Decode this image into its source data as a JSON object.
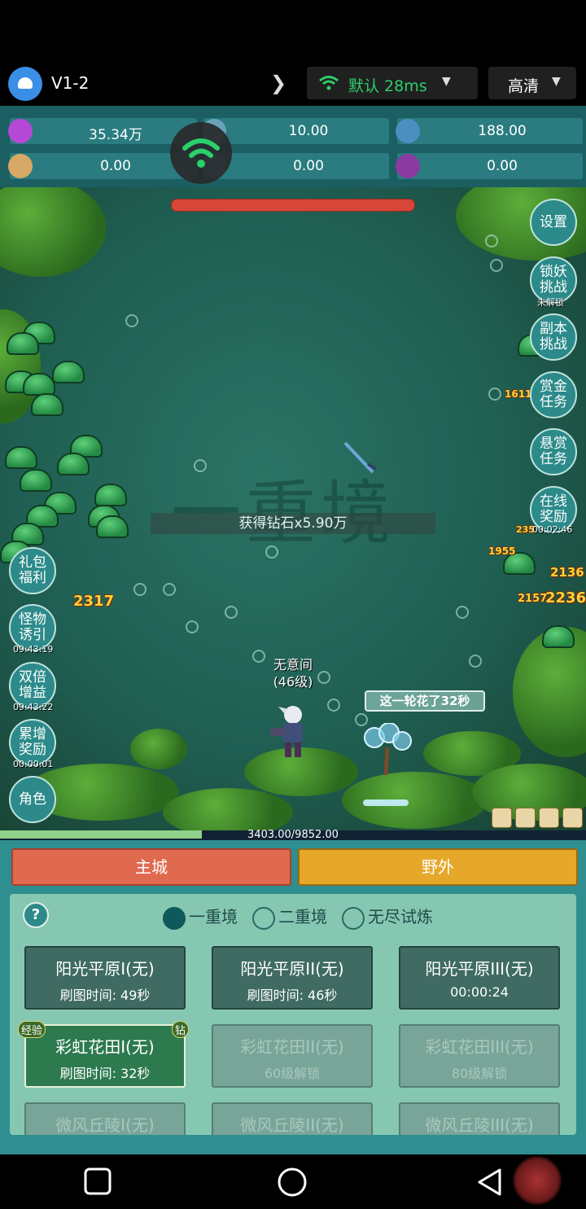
{
  "topbar": {
    "app_title": "V1-2",
    "network_label": "默认 28ms",
    "quality_label": "高清"
  },
  "resources": [
    {
      "icon": "diamond-icon",
      "value": "35.34万"
    },
    {
      "icon": "orb-icon",
      "value": "10.00"
    },
    {
      "icon": "globe-icon",
      "value": "188.00"
    },
    {
      "icon": "scroll-icon",
      "value": "0.00"
    },
    {
      "icon": "crystal-icon",
      "value": "0.00"
    },
    {
      "icon": "potion-icon",
      "value": "0.00"
    }
  ],
  "battle": {
    "watermark": "一重境",
    "gain_message": "获得钻石x5.90万",
    "player_name": "无意间",
    "player_level": "(46级)",
    "round_time": "这一轮花了32秒",
    "hp_text": "3403.00/9852.00",
    "hp_fraction": 0.345,
    "damage_numbers": [
      "2317",
      "1611",
      "1955",
      "2136",
      "2157",
      "2236",
      "235"
    ]
  },
  "right_menu": [
    {
      "label": "设置",
      "sub": ""
    },
    {
      "label": "锁妖挑战",
      "sub": "未解锁"
    },
    {
      "label": "副本挑战",
      "sub": ""
    },
    {
      "label": "赏金任务",
      "sub": ""
    },
    {
      "label": "悬赏任务",
      "sub": ""
    },
    {
      "label": "在线奖励",
      "sub": "00:02:46"
    }
  ],
  "left_menu": [
    {
      "label": "礼包福利",
      "sub": ""
    },
    {
      "label": "怪物诱引",
      "sub": "09:43:19"
    },
    {
      "label": "双倍增益",
      "sub": "09:43:22"
    },
    {
      "label": "累增奖励",
      "sub": "00:00:01"
    },
    {
      "label": "角色",
      "sub": ""
    }
  ],
  "tabs": {
    "main_city": "主城",
    "wild": "野外"
  },
  "realms": {
    "help": "?",
    "items": [
      "一重境",
      "二重境",
      "无尽试炼"
    ],
    "selected": 0
  },
  "stages": [
    {
      "name": "阳光平原I(无)",
      "info": "刷图时间: 49秒",
      "state": "normal"
    },
    {
      "name": "阳光平原II(无)",
      "info": "刷图时间: 46秒",
      "state": "normal"
    },
    {
      "name": "阳光平原III(无)",
      "info": "00:00:24",
      "state": "normal"
    },
    {
      "name": "彩虹花田I(无)",
      "info": "刷图时间: 32秒",
      "state": "active",
      "badge_left": "经验",
      "badge_right": "钻"
    },
    {
      "name": "彩虹花田II(无)",
      "info": "60级解锁",
      "state": "locked"
    },
    {
      "name": "彩虹花田III(无)",
      "info": "80级解锁",
      "state": "locked"
    },
    {
      "name": "微风丘陵I(无)",
      "info": "",
      "state": "locked"
    },
    {
      "name": "微风丘陵II(无)",
      "info": "",
      "state": "locked"
    },
    {
      "name": "微风丘陵III(无)",
      "info": "",
      "state": "locked"
    }
  ],
  "colors": {
    "accent_green": "#2bd06a",
    "main_tab": "#e06a4f",
    "wild_tab": "#e6a82a",
    "panel": "#2f8e90"
  }
}
